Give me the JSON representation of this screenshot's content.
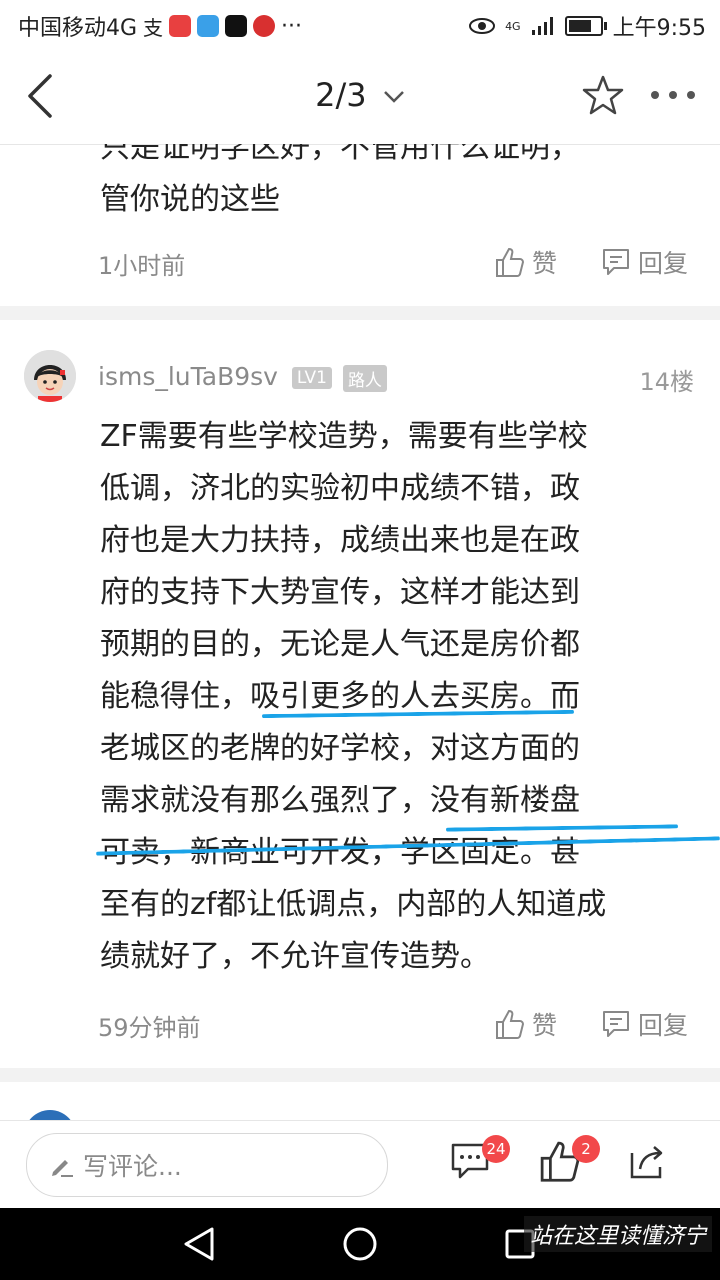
{
  "status": {
    "carrier": "中国移动4G",
    "net": "4G",
    "time": "上午9:55"
  },
  "nav": {
    "page": "2/3"
  },
  "prev_comment": {
    "text_lines": [
      "只是证明学区好，不管用什么证明，",
      "管你说的这些"
    ],
    "time": "1小时前",
    "like_label": "赞",
    "reply_label": "回复"
  },
  "comment": {
    "username": "isms_luTaB9sv",
    "level": "LV1",
    "role": "路人",
    "floor": "14楼",
    "lines": [
      "ZF需要有些学校造势，需要有些学校",
      "低调，济北的实验初中成绩不错，政",
      "府也是大力扶持，成绩出来也是在政",
      "府的支持下大势宣传，这样才能达到",
      "预期的目的，无论是人气还是房价都",
      "能稳得住，吸引更多的人去买房。而",
      "老城区的老牌的好学校，对这方面的",
      "需求就没有那么强烈了，没有新楼盘",
      "可卖，新商业可开发，学区固定。甚",
      "至有的zf都让低调点，内部的人知道成",
      "绩就好了，不允许宣传造势。"
    ],
    "time": "59分钟前",
    "like_label": "赞",
    "reply_label": "回复"
  },
  "bottom": {
    "placeholder": "写评论...",
    "comment_count": "24",
    "like_count": "2"
  },
  "watermark": "站在这里读懂济宁",
  "colors": {
    "underline": "#1aa3e8",
    "badge_red": "#f2484a"
  }
}
